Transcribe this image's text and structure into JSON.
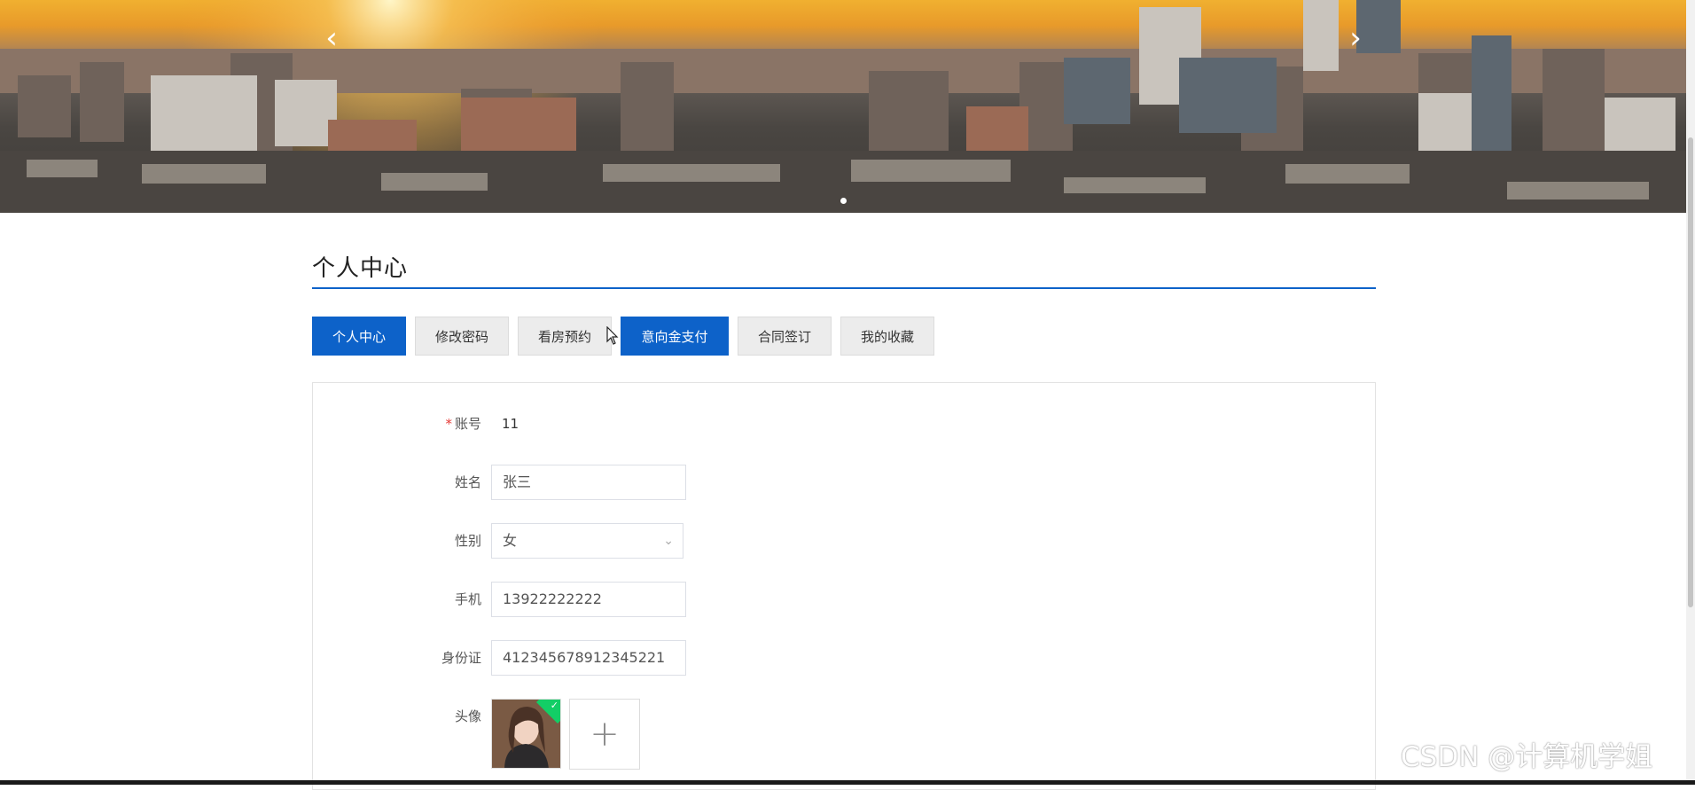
{
  "banner": {
    "prev_icon": "chevron-left-icon",
    "next_icon": "chevron-right-icon",
    "prev_glyph": "‹",
    "next_glyph": "›"
  },
  "page": {
    "title": "个人中心"
  },
  "tabs": [
    {
      "label": "个人中心",
      "active": true
    },
    {
      "label": "修改密码",
      "active": false
    },
    {
      "label": "看房预约",
      "active": false
    },
    {
      "label": "意向金支付",
      "active": true
    },
    {
      "label": "合同签订",
      "active": false
    },
    {
      "label": "我的收藏",
      "active": false
    }
  ],
  "form": {
    "account": {
      "label": "账号",
      "required_mark": "*",
      "value": "11"
    },
    "name": {
      "label": "姓名",
      "value": "张三"
    },
    "gender": {
      "label": "性别",
      "value": "女",
      "arrow": "⌄"
    },
    "phone": {
      "label": "手机",
      "value": "13922222222"
    },
    "id_card": {
      "label": "身份证",
      "value": "412345678912345221"
    },
    "avatar": {
      "label": "头像",
      "upload_plus": "+",
      "check": "✓"
    }
  },
  "watermark": "CSDN @计算机学姐",
  "colors": {
    "primary": "#0d62c9",
    "required": "#e53935",
    "success": "#13ce66"
  }
}
